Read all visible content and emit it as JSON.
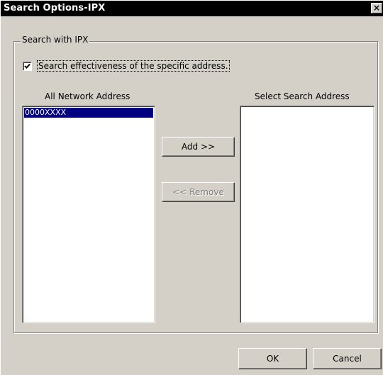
{
  "window": {
    "title": "Search Options-IPX",
    "close_glyph": "×"
  },
  "group": {
    "legend": "Search with IPX",
    "checkbox_label": "Search effectiveness of the specific address.",
    "checkbox_checked": true
  },
  "left_list": {
    "label": "All Network Address",
    "items": [
      "0000XXXX"
    ]
  },
  "right_list": {
    "label": "Select Search Address",
    "items": []
  },
  "buttons": {
    "add": "Add >>",
    "remove": "<< Remove",
    "ok": "OK",
    "cancel": "Cancel"
  }
}
